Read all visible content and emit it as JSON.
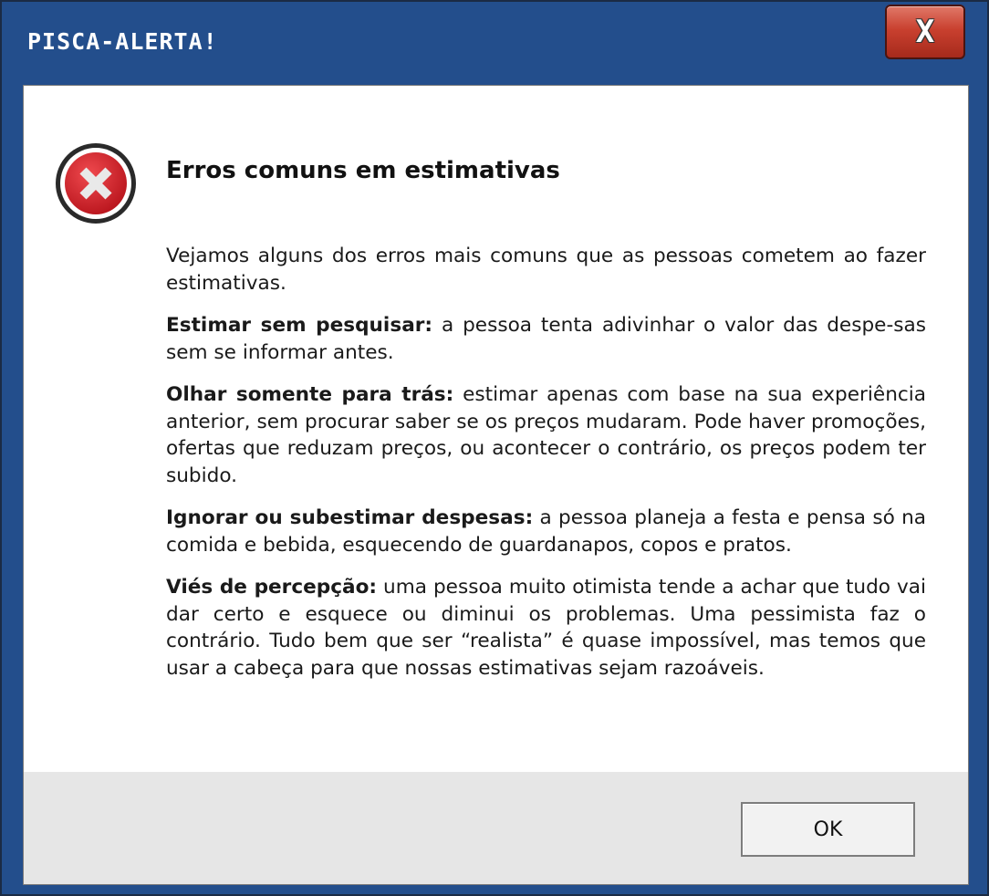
{
  "window": {
    "title": "PISCA-ALERTA!",
    "close_label": "X"
  },
  "dialog": {
    "icon": "error-x-circle-icon",
    "heading": "Erros comuns em estimativas",
    "intro": "Vejamos alguns dos erros mais comuns que as pessoas cometem ao fazer estimativas.",
    "items": [
      {
        "term": "Estimar sem pesquisar:",
        "text": " a pessoa tenta adivinhar o valor das despe-sas sem se informar antes."
      },
      {
        "term": "Olhar somente para trás:",
        "text": " estimar apenas com base na sua experiência anterior, sem procurar saber se os preços mudaram. Pode haver promoções, ofertas que reduzam preços, ou acontecer o contrário, os preços podem ter subido."
      },
      {
        "term": "Ignorar ou subestimar despesas:",
        "text": " a pessoa planeja a festa e pensa só na comida e bebida, esquecendo de guardanapos, copos e pratos."
      },
      {
        "term": "Viés de percepção:",
        "text": " uma pessoa muito otimista tende a achar que tudo vai dar certo e esquece ou diminui os problemas. Uma pessimista faz o contrário. Tudo bem que ser “realista” é quase impossível, mas temos que usar a cabeça para que nossas estimativas sejam razoáveis."
      }
    ],
    "ok_label": "OK"
  },
  "colors": {
    "titlebar": "#234e8c",
    "close_button": "#c9402f",
    "icon_red": "#d11f26",
    "client_background": "#e6e6e6"
  }
}
